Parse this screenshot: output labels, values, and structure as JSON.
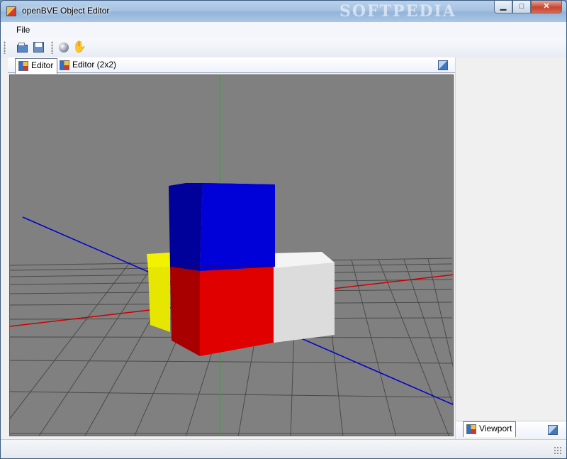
{
  "window": {
    "title": "openBVE Object Editor",
    "watermark": "SOFTPEDIA",
    "controls": {
      "minimize": "▁",
      "maximize": "□",
      "close": "✕"
    }
  },
  "menu": {
    "items": [
      {
        "label": "File"
      }
    ]
  },
  "toolbar": {
    "buttons": [
      {
        "icon": "open-folder-icon"
      },
      {
        "icon": "reload-icon"
      },
      {
        "icon": "globe-icon"
      },
      {
        "icon": "hand-pan-icon"
      }
    ]
  },
  "tabs": [
    {
      "label": "Editor",
      "active": true
    },
    {
      "label": "Editor (2x2)",
      "active": false
    }
  ],
  "side_panel": {
    "tab": {
      "label": "Viewport",
      "active": true
    }
  },
  "colors": {
    "viewport_bg": "#808080",
    "axis_x": "#cc0000",
    "axis_y": "#00cc00",
    "axis_z": "#0000cc",
    "cube_blue": "#0000c8",
    "cube_red": "#e00000",
    "cube_yellow": "#e8e800",
    "cube_white": "#f2f2f2"
  }
}
